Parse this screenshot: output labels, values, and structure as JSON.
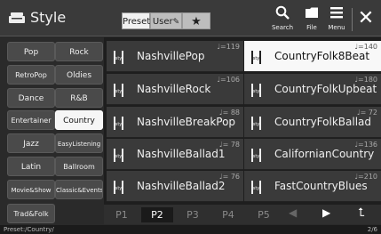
{
  "header": {
    "title": "Style",
    "tabs": {
      "preset": "Preset",
      "user": "User",
      "favorite": "★"
    },
    "search_label": "Search",
    "file_label": "File",
    "menu_label": "Menu",
    "close": "✕"
  },
  "categories": [
    "Pop",
    "Rock",
    "RetroPop",
    "Oldies",
    "Dance",
    "R&B",
    "Entertainer",
    "Country",
    "Jazz",
    "EasyListening",
    "Latin",
    "Ballroom",
    "Movie&Show",
    "Classic&Events",
    "Trad&Folk"
  ],
  "selected_category": "Country",
  "styles": [
    {
      "name": "NashvillePop",
      "tempo": "♩=119"
    },
    {
      "name": "CountryFolk8Beat",
      "tempo": "♩=140"
    },
    {
      "name": "NashvilleRock",
      "tempo": "♩=106"
    },
    {
      "name": "CountryFolkUpbeat",
      "tempo": "♩=180"
    },
    {
      "name": "NashvilleBreakPop",
      "tempo": "♩= 88"
    },
    {
      "name": "CountryFolkBallad",
      "tempo": "♩= 72"
    },
    {
      "name": "NashvilleBallad1",
      "tempo": "♩= 78"
    },
    {
      "name": "CalifornianCountry",
      "tempo": "♩=136"
    },
    {
      "name": "NashvilleBallad2",
      "tempo": "♩= 76"
    },
    {
      "name": "FastCountryBlues",
      "tempo": "♩=210"
    }
  ],
  "selected_style": "CountryFolk8Beat",
  "pages": [
    "P1",
    "P2",
    "P3",
    "P4",
    "P5"
  ],
  "current_page": "P2",
  "nav": {
    "prev": "◀",
    "next": "▶",
    "up": "⮤"
  },
  "status": {
    "path": "Preset:/Country/",
    "page": "2/6"
  }
}
